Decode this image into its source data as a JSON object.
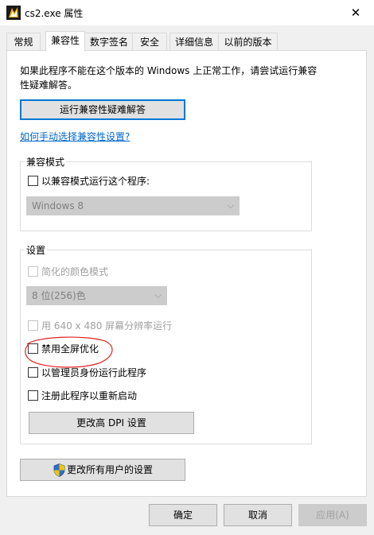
{
  "window": {
    "title": "cs2.exe 属性",
    "close_glyph": "✕"
  },
  "tabs": [
    {
      "label": "常规"
    },
    {
      "label": "兼容性"
    },
    {
      "label": "数字签名"
    },
    {
      "label": "安全"
    },
    {
      "label": "详细信息"
    },
    {
      "label": "以前的版本"
    }
  ],
  "active_tab": "兼容性",
  "compat": {
    "intro": "如果此程序不能在这个版本的 Windows 上正常工作，请尝试运行兼容性疑难解答。",
    "troubleshooter_button": "运行兼容性疑难解答",
    "manual_link": "如何手动选择兼容性设置?",
    "mode_group": {
      "title": "兼容模式",
      "checkbox_label": "以兼容模式运行这个程序:",
      "checked": false,
      "os_select": "Windows 8"
    },
    "settings_group": {
      "title": "设置",
      "reduced_color": {
        "label": "简化的颜色模式",
        "enabled": false,
        "checked": false
      },
      "color_select": "8 位(256)色",
      "low_res": {
        "label": "用 640 x 480 屏幕分辨率运行",
        "enabled": false,
        "checked": false
      },
      "disable_fullscreen_opt": {
        "label": "禁用全屏优化",
        "checked": false,
        "highlighted": true
      },
      "run_as_admin": {
        "label": "以管理员身份运行此程序",
        "checked": false
      },
      "register_restart": {
        "label": "注册此程序以重新启动",
        "checked": false
      },
      "dpi_button": "更改高 DPI 设置"
    },
    "all_users_button": "更改所有用户的设置"
  },
  "footer": {
    "ok": "确定",
    "cancel": "取消",
    "apply": "应用(A)"
  },
  "colors": {
    "accent": "#0078d7",
    "link": "#0066cc",
    "annotation": "#e02020",
    "disabled_text": "#a0a0a0"
  },
  "icons": [
    "app-icon",
    "close-icon",
    "shield-icon",
    "chevron-down-icon"
  ]
}
